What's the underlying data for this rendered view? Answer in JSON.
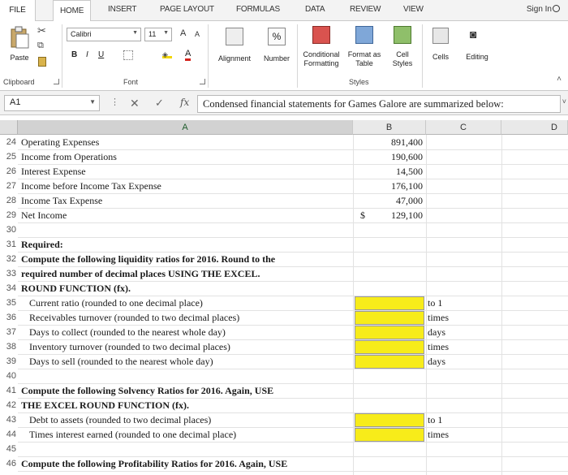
{
  "ribbon_tabs": {
    "file": "FILE",
    "home": "HOME",
    "insert": "INSERT",
    "page_layout": "PAGE LAYOUT",
    "formulas": "FORMULAS",
    "data": "DATA",
    "review": "REVIEW",
    "view": "VIEW",
    "sign_in": "Sign In"
  },
  "ribbon": {
    "paste": "Paste",
    "font_name": "Calibri",
    "font_size": "11",
    "grow_font": "A",
    "shrink_font": "A",
    "bold": "B",
    "italic": "I",
    "underline": "U",
    "font_color": "A",
    "alignment": "Alignment",
    "number": "Number",
    "percent": "%",
    "conditional_formatting_1": "Conditional",
    "conditional_formatting_2": "Formatting",
    "format_as_table_1": "Format as",
    "format_as_table_2": "Table",
    "cell_styles_1": "Cell",
    "cell_styles_2": "Styles",
    "cells": "Cells",
    "editing": "Editing",
    "group_clipboard": "Clipboard",
    "group_font": "Font",
    "group_styles": "Styles"
  },
  "formula_bar": {
    "name_box": "A1",
    "fx": "fx",
    "content": "Condensed financial statements for Games Galore are summarized below:"
  },
  "columns": [
    "A",
    "B",
    "C",
    "D"
  ],
  "rows": [
    {
      "num": "24",
      "a": "Operating Expenses",
      "b": "891,400"
    },
    {
      "num": "25",
      "a": "Income from Operations",
      "b": "190,600"
    },
    {
      "num": "26",
      "a": "Interest Expense",
      "b": "14,500"
    },
    {
      "num": "27",
      "a": "Income before Income Tax Expense",
      "b": "176,100"
    },
    {
      "num": "28",
      "a": "Income Tax Expense",
      "b": "47,000"
    },
    {
      "num": "29",
      "a": "Net Income",
      "b": "129,100",
      "currency": "$"
    },
    {
      "num": "30",
      "a": ""
    },
    {
      "num": "31",
      "a": "Required:",
      "bold": true
    },
    {
      "num": "32",
      "a": "Compute the following liquidity ratios for 2016. Round to the",
      "bold": true
    },
    {
      "num": "33",
      "a": "required number of decimal places USING THE EXCEL.",
      "bold": true
    },
    {
      "num": "34",
      "a": "ROUND FUNCTION (fx).",
      "bold": true
    },
    {
      "num": "35",
      "a": "Current ratio (rounded to one decimal place)",
      "indent": true,
      "unit": "to 1"
    },
    {
      "num": "36",
      "a": "Receivables turnover (rounded to two decimal places)",
      "indent": true,
      "unit": "times"
    },
    {
      "num": "37",
      "a": "Days to collect (rounded to the nearest whole day)",
      "indent": true,
      "unit": "days"
    },
    {
      "num": "38",
      "a": "Inventory turnover (rounded to two decimal places)",
      "indent": true,
      "unit": "times"
    },
    {
      "num": "39",
      "a": "Days to sell (rounded to the nearest whole day)",
      "indent": true,
      "unit": "days"
    },
    {
      "num": "40",
      "a": ""
    },
    {
      "num": "41",
      "a": "Compute the following Solvency Ratios for 2016. Again, USE",
      "bold": true
    },
    {
      "num": "42",
      "a": "THE EXCEL ROUND FUNCTION (fx).",
      "bold": true
    },
    {
      "num": "43",
      "a": "Debt to assets (rounded to two decimal places)",
      "indent": true,
      "unit": "to 1"
    },
    {
      "num": "44",
      "a": "Times interest earned (rounded to one decimal place)",
      "indent": true,
      "unit": "times"
    },
    {
      "num": "45",
      "a": ""
    },
    {
      "num": "46",
      "a": "Compute the following Profitability Ratios for 2016. Again, USE",
      "bold": true
    }
  ],
  "colors": {
    "input_fill": "#f7ec1a",
    "header_bg": "#e9e9e9",
    "selected_header": "#d2d2d2"
  }
}
